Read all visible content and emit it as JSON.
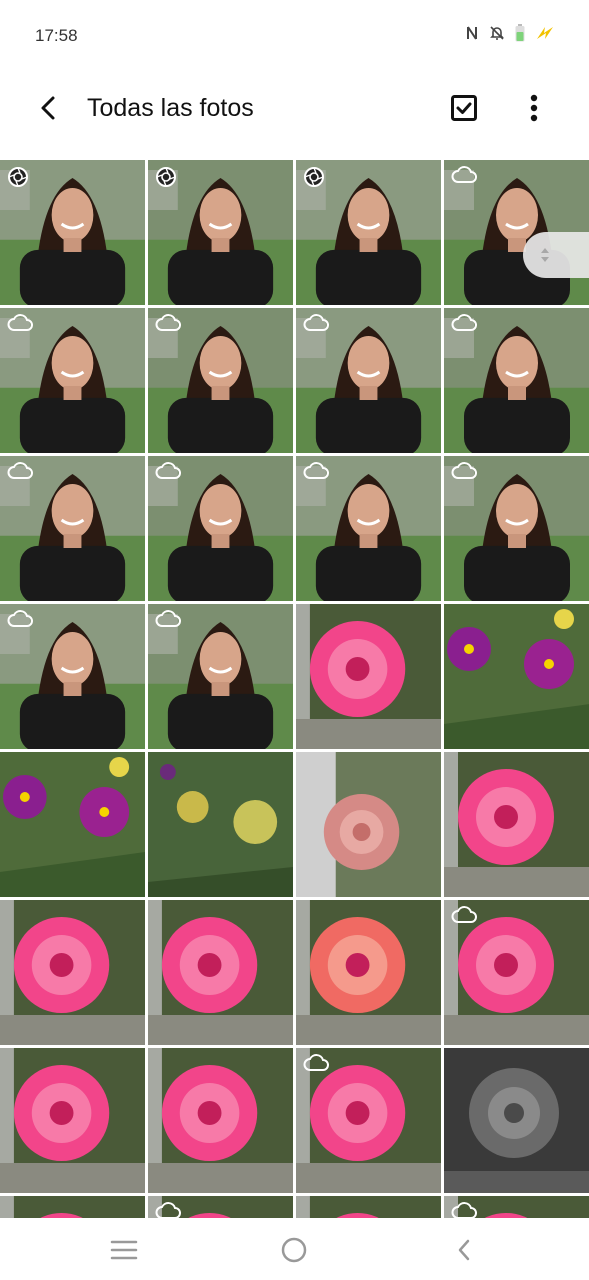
{
  "status_bar": {
    "time": "17:58",
    "icons": [
      "nfc-icon",
      "bell-off-icon",
      "battery-icon",
      "charging-icon"
    ]
  },
  "app_bar": {
    "title": "Todas las fotos",
    "back_icon": "back-arrow-icon",
    "select_icon": "select-checkbox-icon",
    "more_icon": "more-vert-icon"
  },
  "gallery": {
    "tiles": [
      {
        "kind": "portrait",
        "badge": "portrait-mode-icon"
      },
      {
        "kind": "portrait",
        "badge": "portrait-mode-icon"
      },
      {
        "kind": "portrait",
        "badge": "portrait-mode-icon"
      },
      {
        "kind": "portrait",
        "badge": "cloud-icon"
      },
      {
        "kind": "portrait",
        "badge": "cloud-icon"
      },
      {
        "kind": "portrait",
        "badge": "cloud-icon"
      },
      {
        "kind": "portrait",
        "badge": "cloud-icon"
      },
      {
        "kind": "portrait",
        "badge": "cloud-icon"
      },
      {
        "kind": "portrait",
        "badge": "cloud-icon"
      },
      {
        "kind": "portrait",
        "badge": "cloud-icon"
      },
      {
        "kind": "portrait",
        "badge": "cloud-icon"
      },
      {
        "kind": "portrait",
        "badge": "cloud-icon"
      },
      {
        "kind": "portrait",
        "badge": "cloud-icon"
      },
      {
        "kind": "portrait",
        "badge": "cloud-icon"
      },
      {
        "kind": "rose",
        "badge": ""
      },
      {
        "kind": "petunia",
        "badge": ""
      },
      {
        "kind": "petunia",
        "badge": ""
      },
      {
        "kind": "yellow-flowers",
        "badge": ""
      },
      {
        "kind": "peach-rose",
        "badge": ""
      },
      {
        "kind": "rose",
        "badge": ""
      },
      {
        "kind": "rose",
        "badge": ""
      },
      {
        "kind": "rose",
        "badge": ""
      },
      {
        "kind": "rose-coral",
        "badge": ""
      },
      {
        "kind": "rose",
        "badge": "cloud-icon"
      },
      {
        "kind": "rose",
        "badge": ""
      },
      {
        "kind": "rose",
        "badge": ""
      },
      {
        "kind": "rose",
        "badge": "cloud-icon"
      },
      {
        "kind": "rose-bw",
        "badge": ""
      },
      {
        "kind": "rose",
        "badge": ""
      },
      {
        "kind": "rose",
        "badge": "cloud-icon"
      },
      {
        "kind": "rose",
        "badge": ""
      },
      {
        "kind": "rose",
        "badge": "cloud-icon"
      }
    ]
  },
  "scroll_handle_icon": "scroll-handle-icon",
  "nav_bar": {
    "recents_icon": "recents-icon",
    "home_icon": "home-icon",
    "back_icon": "nav-back-icon"
  },
  "colors": {
    "accent_charging": "#f2c200",
    "battery": "#7ed37a"
  }
}
